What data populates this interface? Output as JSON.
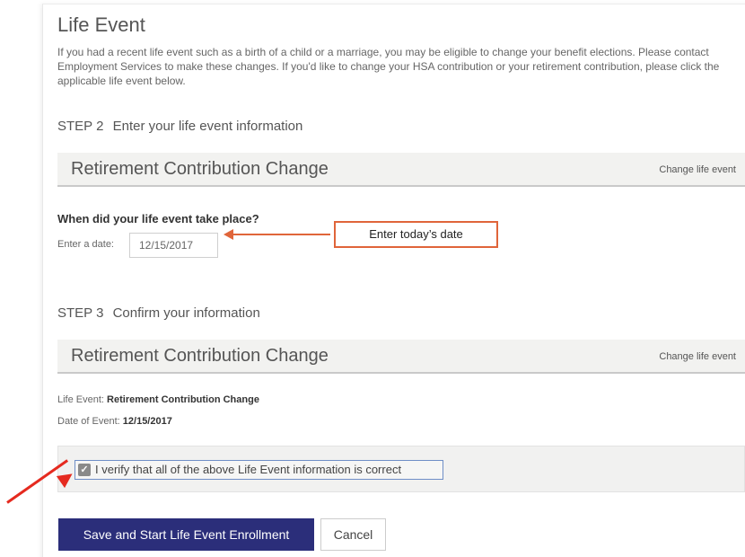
{
  "page": {
    "title": "Life Event",
    "intro": "If you had a recent life event such as a birth of a child or a marriage, you may be eligible to change your benefit elections. Please contact Employment Services to make these changes. If you'd like to change your HSA contribution or your retirement contribution, please click the applicable life event below."
  },
  "step2": {
    "number": "STEP 2",
    "label": "Enter your life event information"
  },
  "section1": {
    "title": "Retirement Contribution Change",
    "link": "Change life event"
  },
  "question": "When did your life event take place?",
  "date": {
    "label": "Enter a date:",
    "value": "12/15/2017"
  },
  "callout": {
    "text": "Enter today’s date",
    "color": "#e0653a"
  },
  "step3": {
    "number": "STEP 3",
    "label": "Confirm your information"
  },
  "section2": {
    "title": "Retirement Contribution Change",
    "link": "Change life event"
  },
  "summary": {
    "life_event_label": "Life Event:",
    "life_event_value": "Retirement Contribution Change",
    "date_label": "Date of Event:",
    "date_value": "12/15/2017"
  },
  "verify": {
    "label": "I verify that all of the above Life Event information is correct",
    "checked": true
  },
  "buttons": {
    "primary": "Save and Start Life Event Enrollment",
    "cancel": "Cancel"
  },
  "colors": {
    "primary_button": "#2b2e7a",
    "annotation_arrow": "#e52a1f"
  }
}
